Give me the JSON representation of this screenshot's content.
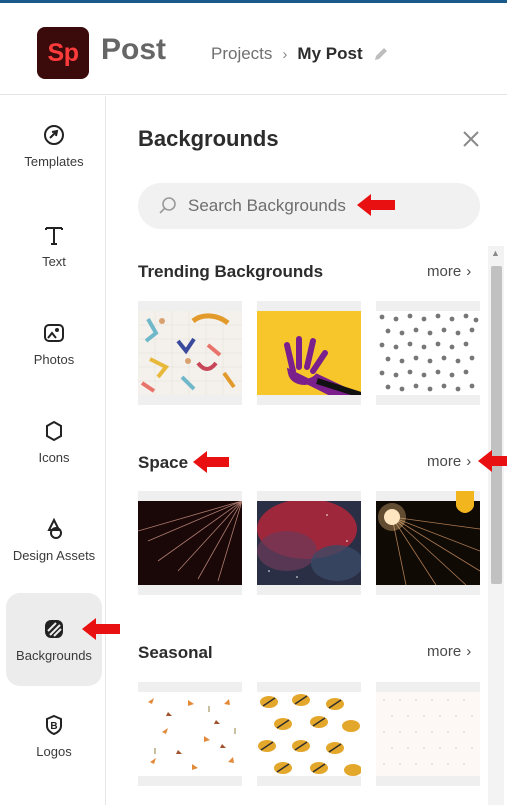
{
  "app": {
    "logo_text": "Sp",
    "name": "Post"
  },
  "breadcrumb": {
    "projects": "Projects",
    "separator": "›",
    "current": "My Post"
  },
  "rail": {
    "items": [
      {
        "label": "Templates",
        "icon": "templates-icon"
      },
      {
        "label": "Text",
        "icon": "text-icon"
      },
      {
        "label": "Photos",
        "icon": "photos-icon"
      },
      {
        "label": "Icons",
        "icon": "icons-icon"
      },
      {
        "label": "Design Assets",
        "icon": "design-assets-icon"
      },
      {
        "label": "Backgrounds",
        "icon": "backgrounds-icon",
        "active": true
      },
      {
        "label": "Logos",
        "icon": "logos-icon"
      }
    ]
  },
  "panel": {
    "title": "Backgrounds",
    "search_placeholder": "Search Backgrounds",
    "sections": [
      {
        "title": "Trending Backgrounds",
        "more": "more"
      },
      {
        "title": "Space",
        "more": "more"
      },
      {
        "title": "Seasonal",
        "more": "more"
      }
    ]
  },
  "colors": {
    "accent_red": "#e81010",
    "logo_bg": "#3b0a0a",
    "logo_text": "#ff3b3b",
    "premium_badge": "#f2b51d"
  }
}
